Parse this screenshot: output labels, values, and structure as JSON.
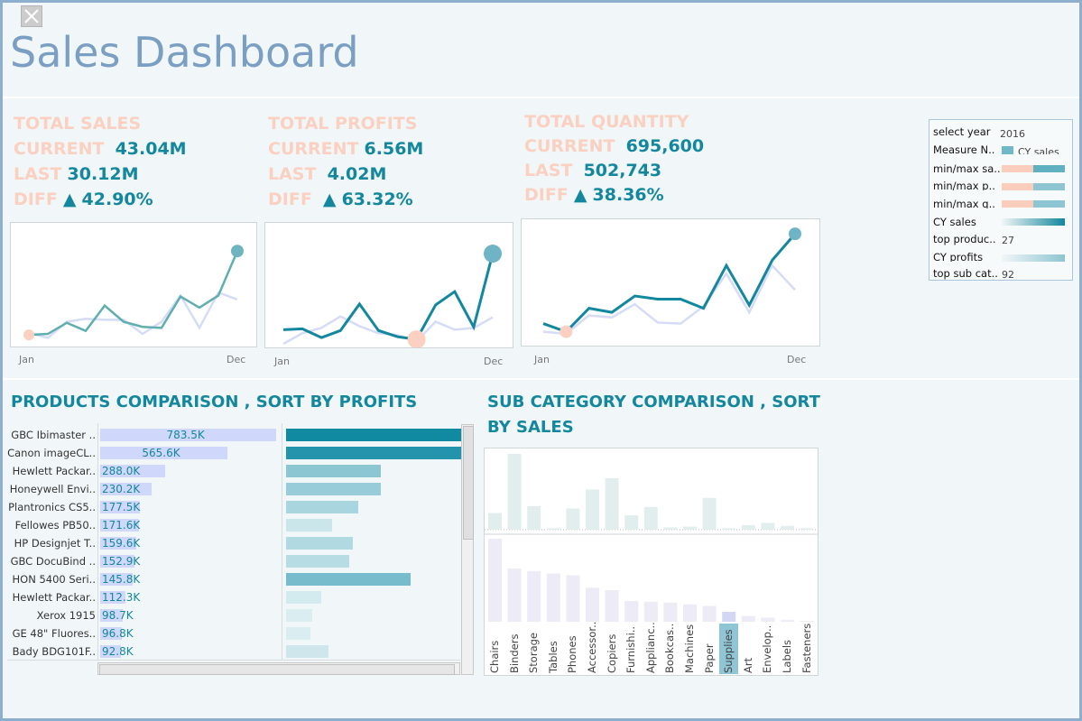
{
  "dashboard": {
    "title": "Sales Dashboard"
  },
  "colors": {
    "teal": "#13879d",
    "peach": "#fbd0c0",
    "light_blue": "#cfd8fb",
    "lavender": "#d6dbf6",
    "title_blue": "#7a9fc3"
  },
  "kpis": [
    {
      "title": "TOTAL SALES",
      "current_label": "CURRENT",
      "current": "43.04M",
      "last_label": "LAST",
      "last": "30.12M",
      "diff_label": "DIFF",
      "arrow": "▲",
      "diff": "42.90%",
      "x_start": "Jan",
      "x_end": "Dec",
      "cy": [
        7,
        8,
        19,
        11,
        36,
        20,
        15,
        14,
        45,
        34,
        46,
        90
      ],
      "py": [
        9,
        4,
        20,
        23,
        22,
        22,
        8,
        20,
        46,
        14,
        49,
        42
      ]
    },
    {
      "title": "TOTAL PROFITS",
      "current_label": "CURRENT",
      "current": "6.56M",
      "last_label": "LAST",
      "last": "4.02M",
      "diff_label": "DIFF",
      "arrow": "▲",
      "diff": "63.32%",
      "x_start": "Jan",
      "x_end": "Dec",
      "cy": [
        17,
        18,
        8,
        16,
        46,
        16,
        9,
        6,
        45,
        60,
        20,
        103
      ],
      "py": [
        1,
        13,
        19,
        32,
        21,
        13,
        11,
        4,
        26,
        17,
        19,
        31
      ]
    },
    {
      "title": "TOTAL QUANTITY",
      "current_label": "CURRENT",
      "current": "695,600",
      "last_label": "LAST",
      "last": "502,743",
      "diff_label": "DIFF",
      "arrow": "▲",
      "diff": "38.36%",
      "x_start": "Jan",
      "x_end": "Dec",
      "cy": [
        11,
        3,
        26,
        22,
        38,
        35,
        35,
        26,
        68,
        29,
        73,
        99
      ],
      "py": [
        3,
        1,
        19,
        17,
        30,
        12,
        11,
        28,
        60,
        22,
        68,
        44
      ]
    }
  ],
  "filters": {
    "select_year_label": "select year",
    "select_year_value": "2016",
    "measure_label": "Measure N..",
    "measure_value": "CY sales",
    "minmax1_label": "min/max sa..",
    "minmax2_label": "min/max p..",
    "minmax3_label": "min/max q..",
    "cy_sales_label": "CY sales",
    "top_products_label": "top produc..",
    "top_products_value": "27",
    "cy_profits_label": "CY profits",
    "top_subcat_label": "top sub cat..",
    "top_subcat_value": "92"
  },
  "products": {
    "title": "PRODUCTS COMPARISON , SORT BY PROFITS",
    "rows": [
      {
        "name": "GBC Ibimaster ..",
        "sales_label": "783.5K",
        "sales": 783.5,
        "profit": 1.0,
        "profit_color": "#0f8aa1"
      },
      {
        "name": "Canon imageCL..",
        "sales_label": "565.6K",
        "sales": 565.6,
        "profit": 1.0,
        "profit_color": "#2394ab"
      },
      {
        "name": "Hewlett Packar..",
        "sales_label": "288.0K",
        "sales": 288.0,
        "profit": 0.54,
        "profit_color": "#8cc6d3"
      },
      {
        "name": "Honeywell Envi..",
        "sales_label": "230.2K",
        "sales": 230.2,
        "profit": 0.54,
        "profit_color": "#98ccd8"
      },
      {
        "name": "Plantronics CS5..",
        "sales_label": "177.5K",
        "sales": 177.5,
        "profit": 0.41,
        "profit_color": "#a9d5df"
      },
      {
        "name": "Fellowes PB50..",
        "sales_label": "171.6K",
        "sales": 171.6,
        "profit": 0.26,
        "profit_color": "#cbe6eb"
      },
      {
        "name": "HP Designjet T..",
        "sales_label": "159.6K",
        "sales": 159.6,
        "profit": 0.38,
        "profit_color": "#b1d9e1"
      },
      {
        "name": "GBC DocuBind ..",
        "sales_label": "152.9K",
        "sales": 152.9,
        "profit": 0.36,
        "profit_color": "#b7dce4"
      },
      {
        "name": "HON 5400 Seri..",
        "sales_label": "145.8K",
        "sales": 145.8,
        "profit": 0.71,
        "profit_color": "#76bccc"
      },
      {
        "name": "Hewlett Packar..",
        "sales_label": "112.3K",
        "sales": 112.3,
        "profit": 0.2,
        "profit_color": "#d3eaee"
      },
      {
        "name": "Xerox 1915",
        "sales_label": "98.7K",
        "sales": 98.7,
        "profit": 0.15,
        "profit_color": "#daedf1"
      },
      {
        "name": "GE 48\" Fluores..",
        "sales_label": "96.8K",
        "sales": 96.8,
        "profit": 0.14,
        "profit_color": "#daedf1"
      },
      {
        "name": "Bady BDG101F..",
        "sales_label": "92.8K",
        "sales": 92.8,
        "profit": 0.24,
        "profit_color": "#cfe7ec"
      }
    ]
  },
  "subcategories": {
    "title_line1": "SUB CATEGORY COMPARISON , SORT",
    "title_line2": "BY SALES",
    "highlight": "Supplies",
    "categories": [
      "Chairs",
      "Binders",
      "Storage",
      "Tables",
      "Phones",
      "Accessor..",
      "Copiers",
      "Furnishi..",
      "Applianc..",
      "Bookcas..",
      "Machines",
      "Paper",
      "Supplies",
      "Art",
      "Envelop..",
      "Labels",
      "Fasteners"
    ],
    "top_values": [
      0.22,
      1.0,
      0.31,
      0.02,
      0.28,
      0.53,
      0.68,
      0.19,
      0.3,
      0.03,
      0.04,
      0.42,
      0.02,
      0.06,
      0.09,
      0.05,
      0.02
    ],
    "bottom_values": [
      1.0,
      0.64,
      0.61,
      0.58,
      0.56,
      0.41,
      0.38,
      0.25,
      0.24,
      0.23,
      0.21,
      0.19,
      0.12,
      0.07,
      0.05,
      0.02,
      0.01
    ]
  }
}
